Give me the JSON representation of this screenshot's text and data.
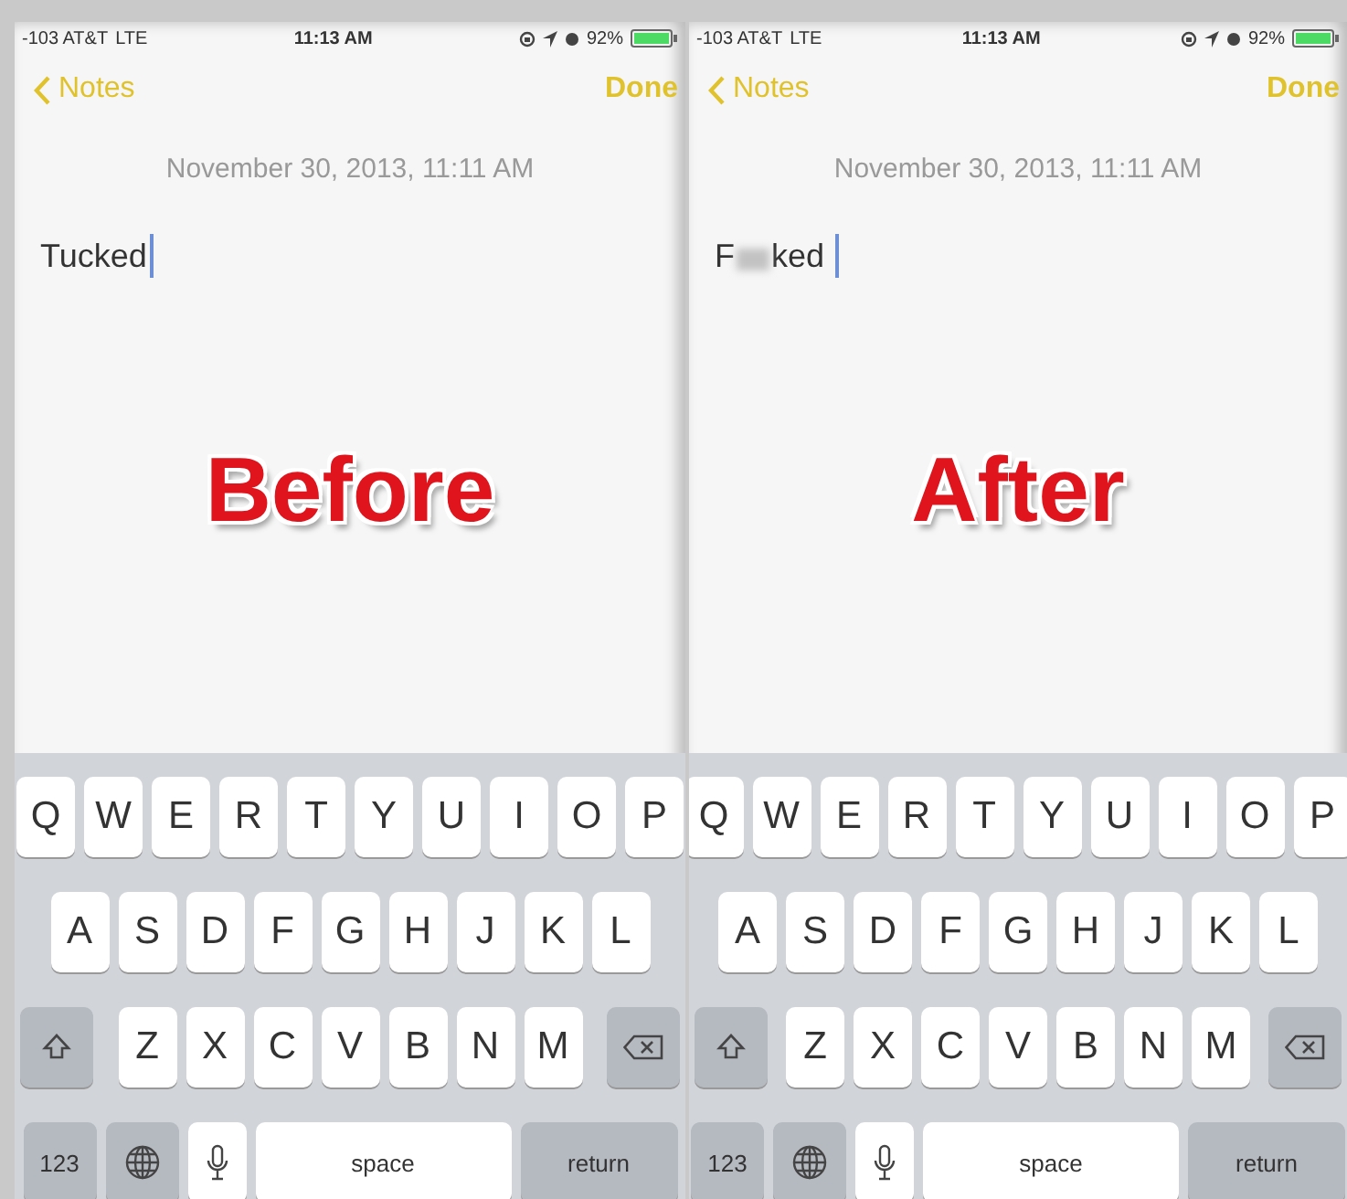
{
  "panels": [
    {
      "status": {
        "carrier": "-103 AT&T",
        "network": "LTE",
        "time": "11:13 AM",
        "battery": "92%"
      },
      "back": "Notes",
      "done": "Done",
      "date": "November 30, 2013, 11:11 AM",
      "note": {
        "kind": "plain",
        "parts": [
          "Tucked"
        ]
      },
      "overlay": "Before",
      "keyboard": {
        "rows": [
          [
            "Q",
            "W",
            "E",
            "R",
            "T",
            "Y",
            "U",
            "I",
            "O",
            "P"
          ],
          [
            "A",
            "S",
            "D",
            "F",
            "G",
            "H",
            "J",
            "K",
            "L"
          ],
          [
            "Z",
            "X",
            "C",
            "V",
            "B",
            "N",
            "M"
          ]
        ],
        "numbers": "123",
        "space": "space",
        "return": "return"
      }
    },
    {
      "status": {
        "carrier": "-103 AT&T",
        "network": "LTE",
        "time": "11:13 AM",
        "battery": "92%"
      },
      "back": "Notes",
      "done": "Done",
      "date": "November 30, 2013, 11:11 AM",
      "note": {
        "kind": "censored",
        "parts": [
          "F",
          "ked"
        ]
      },
      "overlay": "After",
      "keyboard": {
        "rows": [
          [
            "Q",
            "W",
            "E",
            "R",
            "T",
            "Y",
            "U",
            "I",
            "O",
            "P"
          ],
          [
            "A",
            "S",
            "D",
            "F",
            "G",
            "H",
            "J",
            "K",
            "L"
          ],
          [
            "Z",
            "X",
            "C",
            "V",
            "B",
            "N",
            "M"
          ]
        ],
        "numbers": "123",
        "space": "space",
        "return": "return"
      }
    }
  ]
}
